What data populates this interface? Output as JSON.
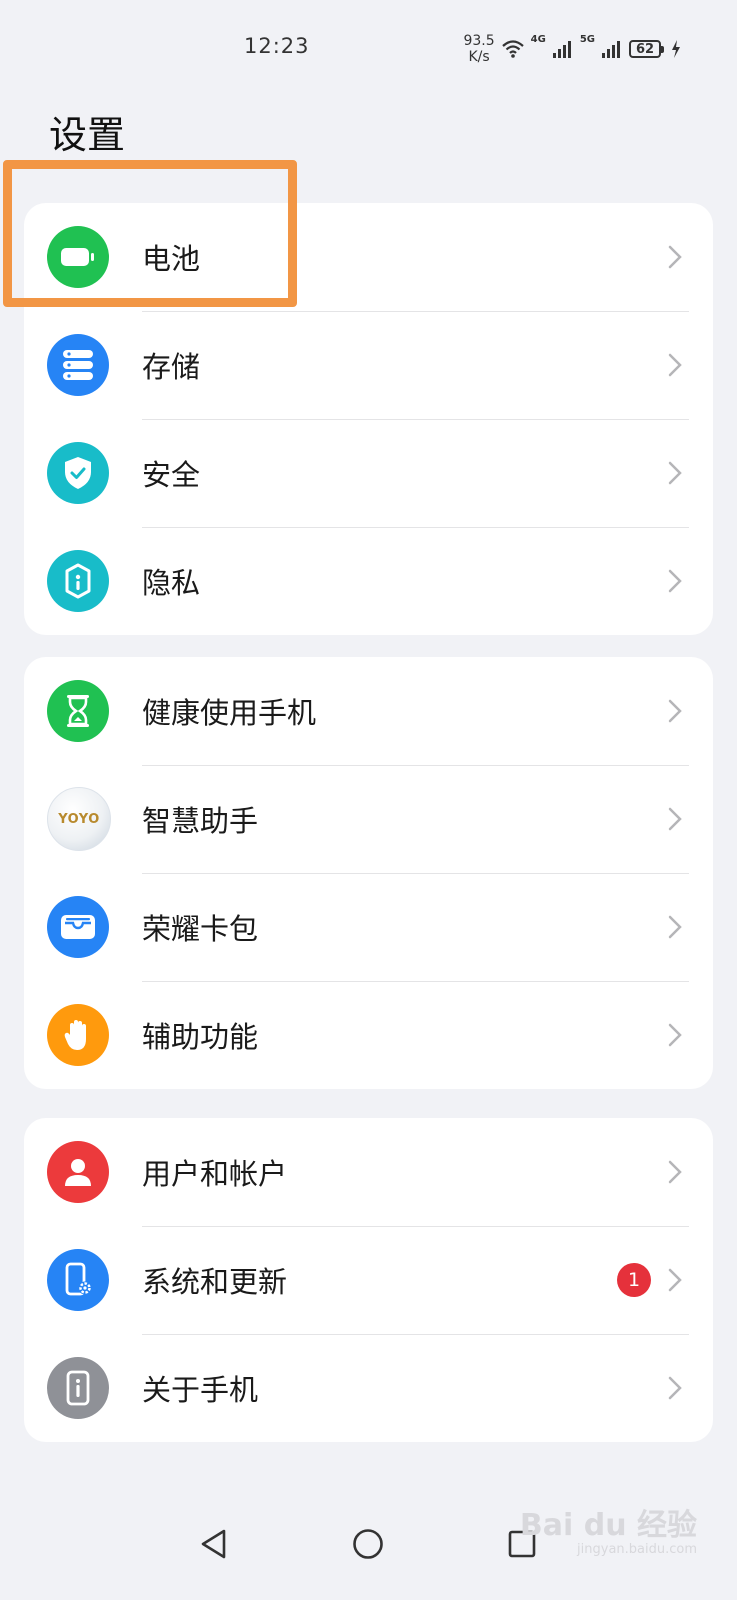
{
  "status_bar": {
    "time": "12:23",
    "speed_value": "93.5",
    "speed_unit": "K/s",
    "sig1_label": "4G",
    "sig2_label": "5G",
    "battery": "62"
  },
  "page_title": "设置",
  "groups": [
    {
      "items": [
        {
          "label": "电池",
          "icon": "battery-icon",
          "color": "#20c152"
        },
        {
          "label": "存储",
          "icon": "storage-icon",
          "color": "#2684f5"
        },
        {
          "label": "安全",
          "icon": "shield-icon",
          "color": "#18bcc9"
        },
        {
          "label": "隐私",
          "icon": "privacy-lock-icon",
          "color": "#18bcc9"
        }
      ]
    },
    {
      "items": [
        {
          "label": "健康使用手机",
          "icon": "hourglass-icon",
          "color": "#20c152"
        },
        {
          "label": "智慧助手",
          "icon": "yoyo-assistant-icon",
          "icon_text": "YOYO",
          "color": "#e9ecef"
        },
        {
          "label": "荣耀卡包",
          "icon": "wallet-icon",
          "color": "#2684f5"
        },
        {
          "label": "辅助功能",
          "icon": "hand-icon",
          "color": "#ff9a0d"
        }
      ]
    },
    {
      "items": [
        {
          "label": "用户和帐户",
          "icon": "user-icon",
          "color": "#ec3a3c"
        },
        {
          "label": "系统和更新",
          "icon": "system-update-icon",
          "color": "#2684f5",
          "badge": "1"
        },
        {
          "label": "关于手机",
          "icon": "about-phone-icon",
          "color": "#8f9197"
        }
      ]
    }
  ],
  "watermark": {
    "text": "Bai du 经验",
    "sub": "jingyan.baidu.com"
  }
}
